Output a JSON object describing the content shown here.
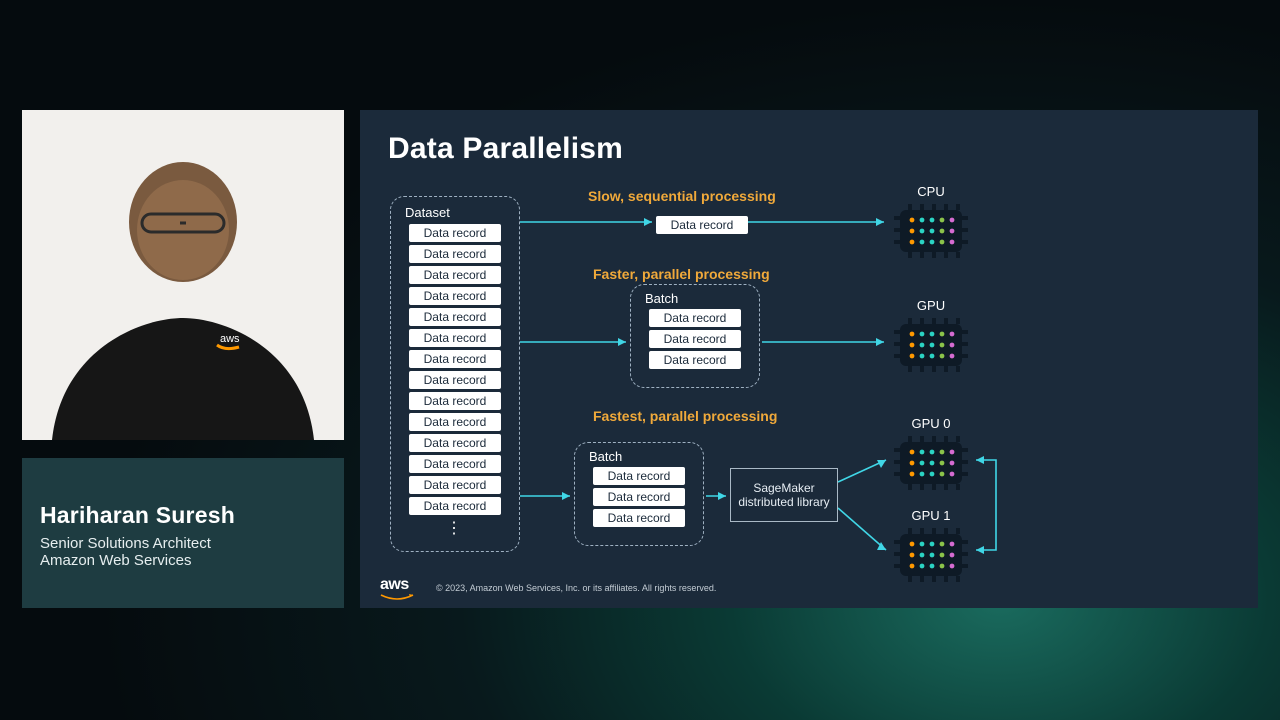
{
  "presenter": {
    "name": "Hariharan Suresh",
    "role": "Senior Solutions Architect",
    "org": "Amazon Web Services"
  },
  "slide": {
    "title": "Data Parallelism",
    "footer_brand": "aws",
    "copyright": "© 2023, Amazon Web Services, Inc. or its affiliates. All rights reserved.",
    "dataset_label": "Dataset",
    "record_label": "Data record",
    "batch_label": "Batch",
    "ellipsis": "⋮",
    "captions": {
      "slow": "Slow, sequential processing",
      "fast": "Faster, parallel processing",
      "fastest": "Fastest, parallel processing"
    },
    "sagemaker": "SageMaker distributed library",
    "chips": {
      "cpu": "CPU",
      "gpu": "GPU",
      "gpu0": "GPU 0",
      "gpu1": "GPU 1"
    },
    "dataset_records": 14,
    "batch_records": 3
  }
}
